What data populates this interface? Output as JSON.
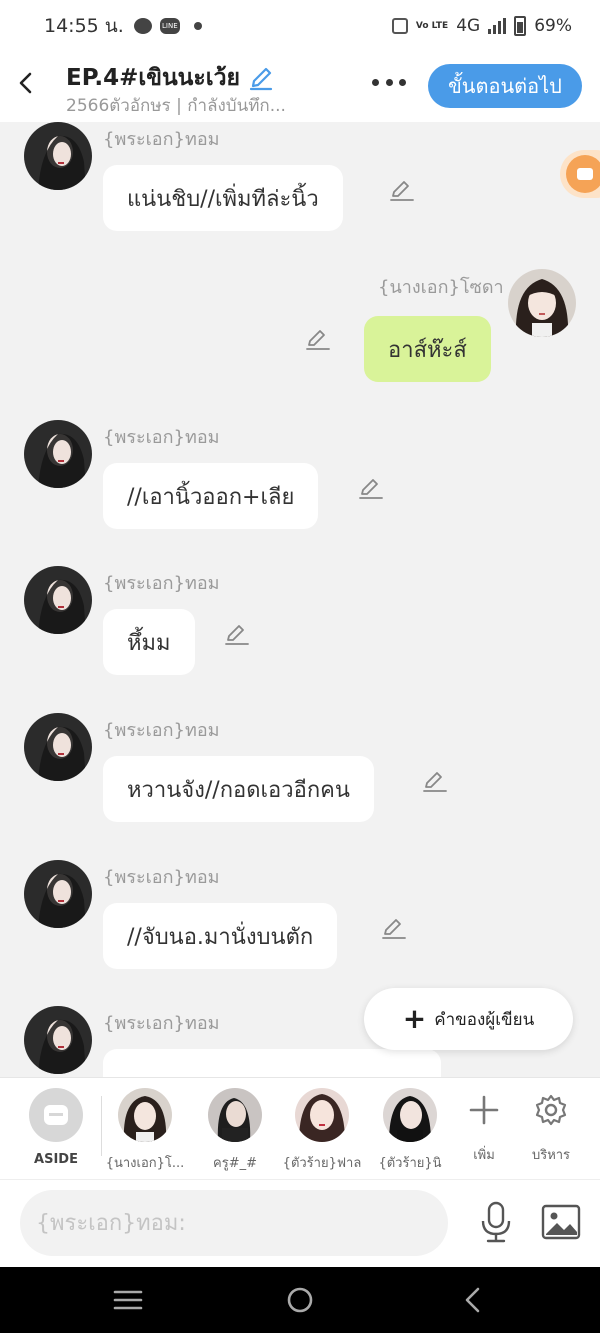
{
  "status_bar": {
    "time": "14:55 น.",
    "network": "4G",
    "battery": "69%",
    "vo_lte": "Vo LTE"
  },
  "header": {
    "title": "EP.4#เขินนะเว้ย",
    "subtitle": "2566ตัวอักษร | กำลังบันทึก...",
    "next_button": "ขั้นตอนต่อไป"
  },
  "messages": [
    {
      "speaker": "{พระเอก}ทอม",
      "text": "แน่นชิบ//เพิ่มทีล่ะนิ้ว",
      "side": "left",
      "color": "#ffffff"
    },
    {
      "speaker": "{นางเอก}โซดา",
      "text": "อาส์ห๊ะส์",
      "side": "right",
      "color": "#d9f399"
    },
    {
      "speaker": "{พระเอก}ทอม",
      "text": "//เอานิ้วออก+เลีย",
      "side": "left",
      "color": "#ffffff"
    },
    {
      "speaker": "{พระเอก}ทอม",
      "text": "หึ้มม",
      "side": "left",
      "color": "#ffffff"
    },
    {
      "speaker": "{พระเอก}ทอม",
      "text": "หวานจัง//กอดเอวอีกคน",
      "side": "left",
      "color": "#ffffff"
    },
    {
      "speaker": "{พระเอก}ทอม",
      "text": "//จับนอ.มานั่งบนตัก",
      "side": "left",
      "color": "#ffffff"
    },
    {
      "speaker": "{พระเอก}ทอม",
      "text": "",
      "side": "left",
      "color": "#ffffff"
    }
  ],
  "writer_button": "คำของผู้เขียน",
  "character_bar": {
    "aside_label": "ASIDE",
    "characters": [
      {
        "label": "{นางเอก}โ..."
      },
      {
        "label": "ครู#_#"
      },
      {
        "label": "{ตัวร้าย}ฟาล"
      },
      {
        "label": "{ตัวร้าย}นิ"
      }
    ],
    "add_label": "เพิ่ม",
    "manage_label": "บริหาร"
  },
  "input": {
    "placeholder": "{พระเอก}ทอม:",
    "value": ""
  },
  "colors": {
    "accent": "#4a9be8",
    "bubble_own": "#d9f399",
    "bubble_other": "#ffffff",
    "background": "#f2f2f2"
  },
  "icons": {
    "back": "back-arrow-icon",
    "edit_title": "pencil-icon",
    "more": "more-icon",
    "edit_message": "pencil-icon",
    "record": "camera-icon",
    "add": "plus-icon",
    "manage": "gear-icon",
    "mic": "microphone-icon",
    "image": "image-icon",
    "nav_menu": "menu-icon",
    "nav_home": "home-icon",
    "nav_back": "back-nav-icon"
  }
}
